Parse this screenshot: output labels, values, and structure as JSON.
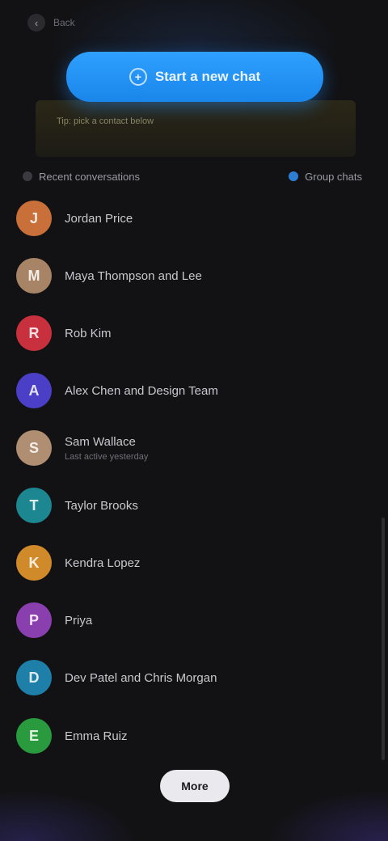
{
  "header": {
    "back_icon": "chevron-left-icon",
    "label": "Back"
  },
  "cta": {
    "label": "Start a new chat",
    "icon": "plus-icon",
    "color": "#1a86ea"
  },
  "banner": {
    "text": "Tip: pick a contact below"
  },
  "filters": [
    {
      "label": "Recent conversations",
      "active": false
    },
    {
      "label": "Group chats",
      "active": true
    }
  ],
  "contacts": [
    {
      "initial": "J",
      "name": "Jordan Price",
      "sub": "",
      "color": "#c9703a"
    },
    {
      "initial": "M",
      "name": "Maya Thompson and Lee",
      "sub": "",
      "color": "#a88466"
    },
    {
      "initial": "R",
      "name": "Rob Kim",
      "sub": "",
      "color": "#c8303d"
    },
    {
      "initial": "A",
      "name": "Alex Chen and Design Team",
      "sub": "",
      "color": "#4a3fc6"
    },
    {
      "initial": "S",
      "name": "Sam Wallace",
      "sub": "Last active yesterday",
      "color": "#b08e72"
    },
    {
      "initial": "T",
      "name": "Taylor Brooks",
      "sub": "",
      "color": "#1c8790"
    },
    {
      "initial": "K",
      "name": "Kendra Lopez",
      "sub": "",
      "color": "#d08a2a"
    },
    {
      "initial": "P",
      "name": "Priya",
      "sub": "",
      "color": "#8a3fae"
    },
    {
      "initial": "D",
      "name": "Dev Patel and Chris Morgan",
      "sub": "",
      "color": "#1e7fa8"
    },
    {
      "initial": "E",
      "name": "Emma Ruiz",
      "sub": "",
      "color": "#2a9a3e"
    }
  ],
  "more_button": {
    "label": "More"
  }
}
